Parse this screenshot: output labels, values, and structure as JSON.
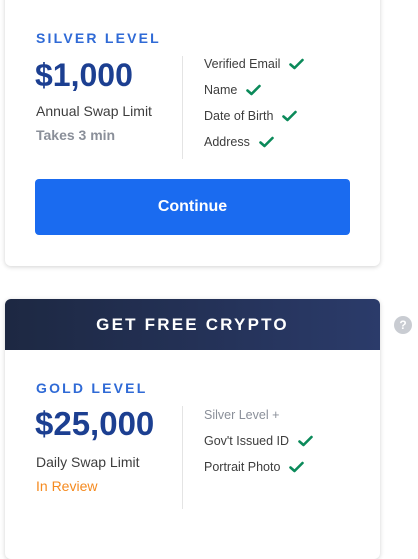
{
  "silver": {
    "level_title": "SILVER LEVEL",
    "amount": "$1,000",
    "limit_label": "Annual Swap Limit",
    "status": "Takes 3 min",
    "requirements": [
      {
        "label": "Verified Email",
        "checked": true
      },
      {
        "label": "Name",
        "checked": true
      },
      {
        "label": "Date of Birth",
        "checked": true
      },
      {
        "label": "Address",
        "checked": true
      }
    ],
    "cta_label": "Continue"
  },
  "gold": {
    "banner": "GET FREE CRYPTO",
    "level_title": "GOLD LEVEL",
    "amount": "$25,000",
    "limit_label": "Daily Swap Limit",
    "status": "In Review",
    "requirements": [
      {
        "label": "Silver Level +",
        "checked": false
      },
      {
        "label": "Gov't Issued ID",
        "checked": true
      },
      {
        "label": "Portrait Photo",
        "checked": true
      }
    ]
  },
  "help_icon": "?",
  "colors": {
    "accent": "#1a6bf0",
    "amount": "#1c3f91",
    "check": "#0b8a5a",
    "in_review": "#f58a1f",
    "muted": "#8a8f99",
    "banner": "#1d2842"
  }
}
